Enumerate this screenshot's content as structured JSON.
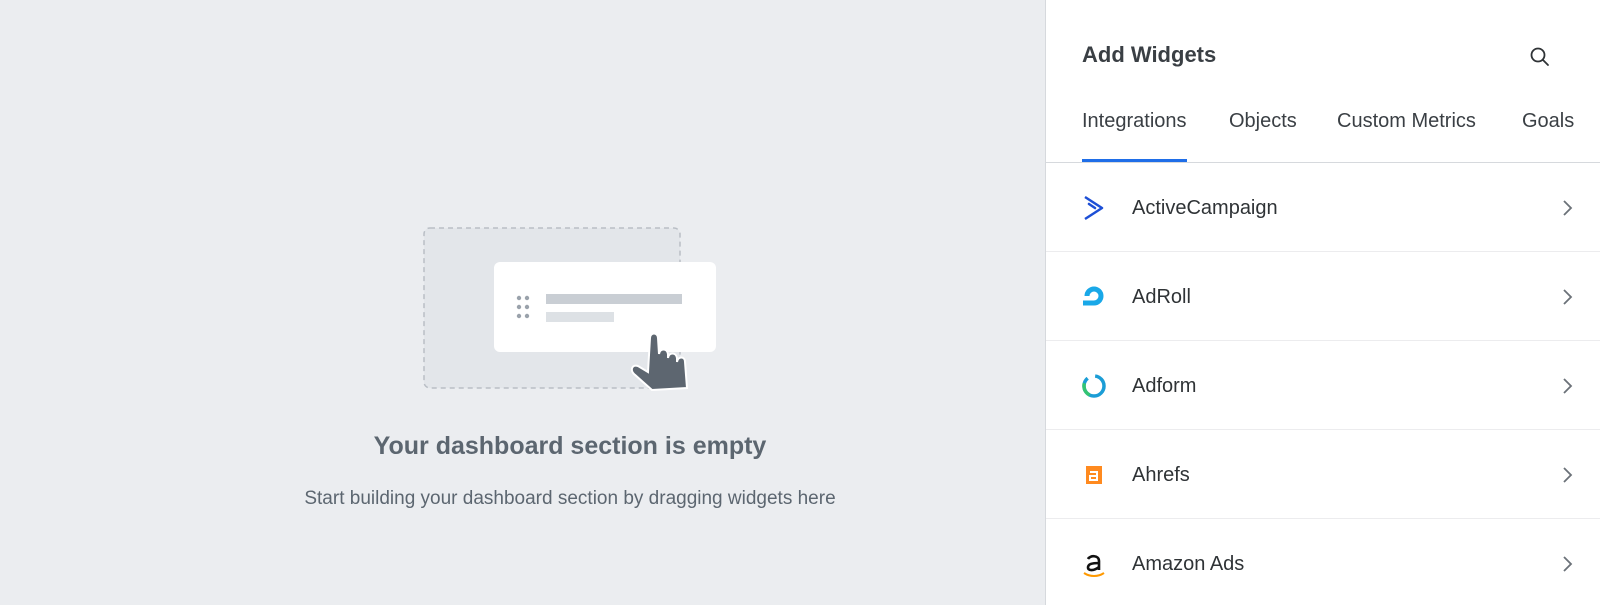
{
  "empty_state": {
    "title": "Your dashboard section is empty",
    "subtitle": "Start building your dashboard section by dragging widgets here"
  },
  "panel": {
    "title": "Add Widgets",
    "search_icon": "search-icon",
    "tabs": [
      {
        "label": "Integrations",
        "active": true
      },
      {
        "label": "Objects",
        "active": false
      },
      {
        "label": "Custom Metrics",
        "active": false
      },
      {
        "label": "Goals",
        "active": false
      }
    ],
    "integrations": [
      {
        "name": "ActiveCampaign",
        "icon": "activecampaign-icon"
      },
      {
        "name": "AdRoll",
        "icon": "adroll-icon"
      },
      {
        "name": "Adform",
        "icon": "adform-icon"
      },
      {
        "name": "Ahrefs",
        "icon": "ahrefs-icon"
      },
      {
        "name": "Amazon Ads",
        "icon": "amazon-ads-icon"
      }
    ]
  },
  "colors": {
    "accent": "#1f6ee8",
    "canvas_bg": "#ebedf0",
    "panel_bg": "#ffffff"
  }
}
